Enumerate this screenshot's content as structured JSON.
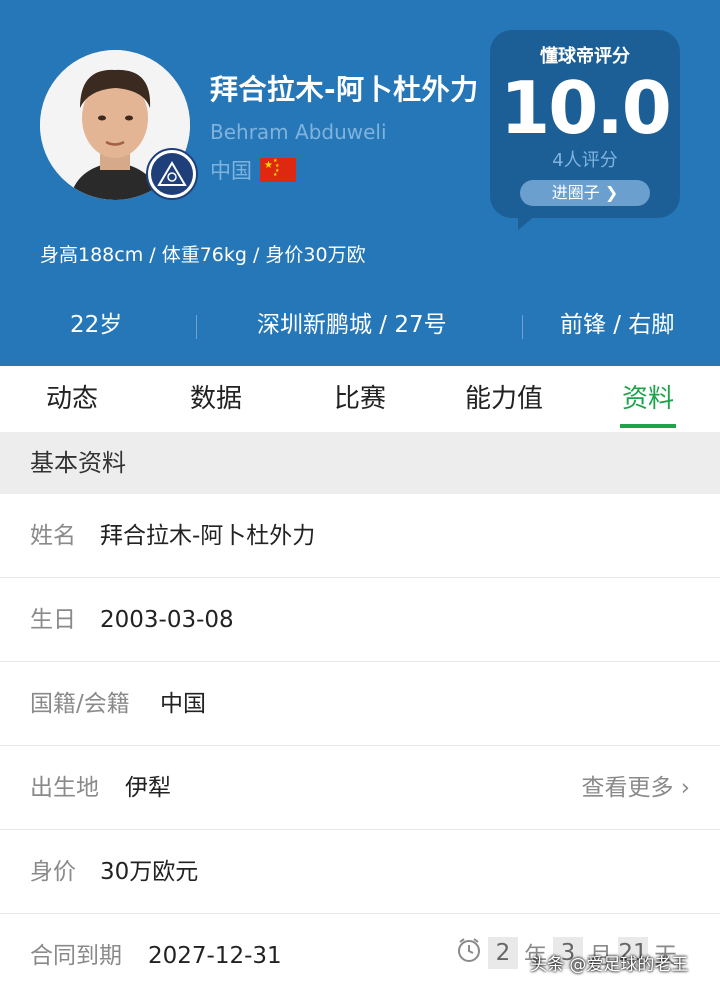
{
  "player": {
    "name_cn": "拜合拉木-阿卜杜外力",
    "name_en": "Behram Abduweli",
    "nationality": "中国",
    "stats_line": "身高188cm / 体重76kg / 身价30万欧",
    "age": "22岁",
    "club_number": "深圳新鹏城 / 27号",
    "position_foot": "前锋 / 右脚"
  },
  "rating": {
    "title": "懂球帝评分",
    "score": "10.0",
    "count": "4人评分",
    "circle_button": "进圈子 ❯"
  },
  "tabs": [
    {
      "label": "动态",
      "active": false
    },
    {
      "label": "数据",
      "active": false
    },
    {
      "label": "比赛",
      "active": false
    },
    {
      "label": "能力值",
      "active": false
    },
    {
      "label": "资料",
      "active": true
    }
  ],
  "section_title": "基本资料",
  "info_rows": [
    {
      "label": "姓名",
      "value": "拜合拉木-阿卜杜外力"
    },
    {
      "label": "生日",
      "value": "2003-03-08"
    },
    {
      "label": "国籍/会籍",
      "value": "中国"
    },
    {
      "label": "出生地",
      "value": "伊犁",
      "more": "查看更多 ›"
    },
    {
      "label": "身价",
      "value": "30万欧元"
    },
    {
      "label": "合同到期",
      "value": "2027-12-31"
    }
  ],
  "contract_countdown": {
    "years": "2",
    "year_unit": "年",
    "months": "3",
    "month_unit": "月",
    "days": "21",
    "day_unit": "天"
  },
  "watermark": "头条 @爱足球的老王",
  "colors": {
    "header_bg": "#2677b8",
    "rating_bg": "#1c5f97",
    "active_tab": "#1ea34b",
    "muted_text": "#8a8a8a"
  },
  "icons": [
    "player-avatar",
    "club-badge-icon",
    "china-flag-icon",
    "chevron-right-icon",
    "clock-icon"
  ]
}
